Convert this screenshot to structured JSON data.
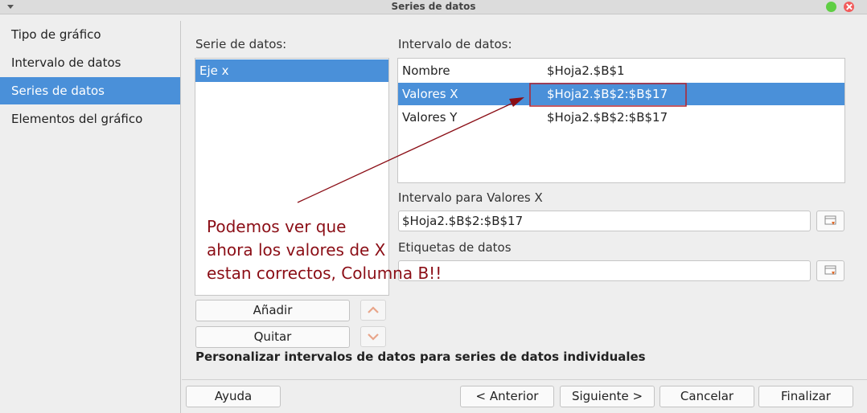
{
  "window": {
    "title": "Series de datos"
  },
  "sidebar": {
    "items": [
      {
        "label": "Tipo de gráfico"
      },
      {
        "label": "Intervalo de datos"
      },
      {
        "label": "Series de datos"
      },
      {
        "label": "Elementos del gráfico"
      }
    ]
  },
  "series_panel": {
    "label": "Serie de datos:",
    "items": [
      {
        "label": "Eje x"
      }
    ],
    "add_label": "Añadir",
    "remove_label": "Quitar"
  },
  "range_panel": {
    "label": "Intervalo de datos:",
    "rows": [
      {
        "name": "Nombre",
        "value": "$Hoja2.$B$1"
      },
      {
        "name": "Valores X",
        "value": "$Hoja2.$B$2:$B$17"
      },
      {
        "name": "Valores Y",
        "value": "$Hoja2.$B$2:$B$17"
      }
    ],
    "x_range_label": "Intervalo para Valores X",
    "x_range_value": "$Hoja2.$B$2:$B$17",
    "data_labels_label": "Etiquetas de datos",
    "data_labels_value": ""
  },
  "annotation": {
    "lines": [
      "Podemos ver que",
      "ahora los valores de X",
      "estan correctos, Columna B!!"
    ]
  },
  "note": "Personalizar intervalos de datos para series de datos individuales",
  "footer": {
    "help": "Ayuda",
    "back": "< Anterior",
    "next": "Siguiente >",
    "cancel": "Cancelar",
    "finish": "Finalizar"
  },
  "colors": {
    "selection": "#4a90d9",
    "annotation": "#8b0e16"
  }
}
